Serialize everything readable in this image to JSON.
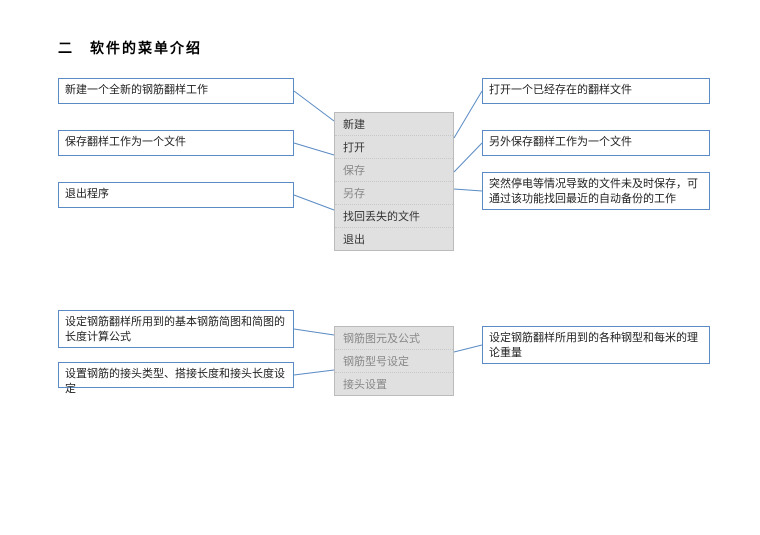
{
  "title": "二　软件的菜单介绍",
  "group1": {
    "menu": {
      "items": [
        {
          "label": "新建",
          "dim": false
        },
        {
          "label": "打开",
          "dim": false
        },
        {
          "label": "保存",
          "dim": true
        },
        {
          "label": "另存",
          "dim": true
        },
        {
          "label": "找回丢失的文件",
          "dim": false
        },
        {
          "label": "退出",
          "dim": false
        }
      ]
    },
    "left": [
      {
        "text": "新建一个全新的钢筋翻样工作"
      },
      {
        "text": "保存翻样工作为一个文件"
      },
      {
        "text": "退出程序"
      }
    ],
    "right": [
      {
        "text": "打开一个已经存在的翻样文件"
      },
      {
        "text": "另外保存翻样工作为一个文件"
      },
      {
        "text": "突然停电等情况导致的文件未及时保存，可通过该功能找回最近的自动备份的工作"
      }
    ]
  },
  "group2": {
    "menu": {
      "items": [
        {
          "label": "钢筋图元及公式",
          "dim": true
        },
        {
          "label": "钢筋型号设定",
          "dim": true
        },
        {
          "label": "接头设置",
          "dim": true
        }
      ]
    },
    "left": [
      {
        "text": "设定钢筋翻样所用到的基本钢筋简图和简图的长度计算公式"
      },
      {
        "text": "设置钢筋的接头类型、搭接长度和接头长度设定"
      }
    ],
    "right": [
      {
        "text": "设定钢筋翻样所用到的各种钢型和每米的理论重量"
      }
    ]
  }
}
